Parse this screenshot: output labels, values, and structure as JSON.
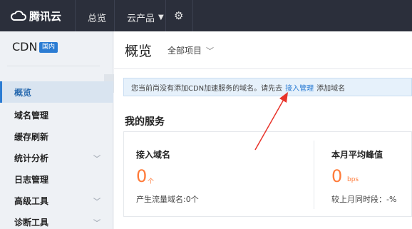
{
  "topbar": {
    "brand": "腾讯云",
    "overview": "总览",
    "products": "云产品",
    "products_icon": "chevron-down-icon",
    "gear_icon": "gear-icon"
  },
  "sidebar": {
    "title": "CDN",
    "badge": "国内",
    "collapse_glyph": "«",
    "items": [
      {
        "label": "概览",
        "active": true,
        "expandable": false
      },
      {
        "label": "域名管理",
        "active": false,
        "expandable": false
      },
      {
        "label": "缓存刷新",
        "active": false,
        "expandable": false
      },
      {
        "label": "统计分析",
        "active": false,
        "expandable": true
      },
      {
        "label": "日志管理",
        "active": false,
        "expandable": false
      },
      {
        "label": "高级工具",
        "active": false,
        "expandable": true
      },
      {
        "label": "诊断工具",
        "active": false,
        "expandable": true
      }
    ]
  },
  "main": {
    "title": "概览",
    "project_select": "全部项目",
    "notice": {
      "before": "您当前尚没有添加CDN加速服务的域名。请先去",
      "link": "接入管理",
      "after": "添加域名"
    },
    "section_title": "我的服务",
    "stats": {
      "domains": {
        "label": "接入域名",
        "value": "0",
        "unit": "个",
        "sub": "产生流量域名:0个"
      },
      "peak": {
        "label": "本月平均峰值",
        "value": "0",
        "unit": "bps",
        "sub": "较上月同时段：-%"
      }
    }
  },
  "colors": {
    "topbar": "#2b2f3b",
    "accent": "#2b7cd3",
    "stat_value": "#ff7b3a",
    "annotation_arrow": "#e8332a"
  }
}
